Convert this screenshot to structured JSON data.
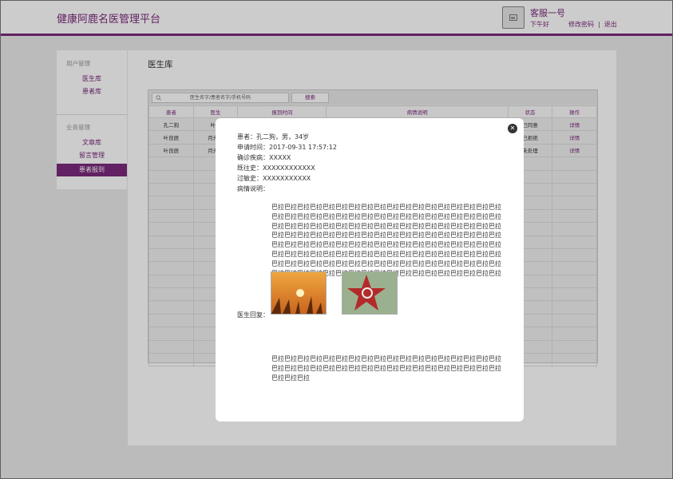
{
  "header": {
    "app_title": "健康阿鹿名医管理平台",
    "user_name": "客服一号",
    "greeting": "下午好",
    "change_password": "修改密码",
    "separator": "|",
    "logout": "退出"
  },
  "sidebar": {
    "group1": "用户管理",
    "group1_items": [
      "医生库",
      "患者库"
    ],
    "group2": "业务管理",
    "group2_items": [
      "文章库",
      "留言管理",
      "患者报到"
    ]
  },
  "page_title": "医生库",
  "search": {
    "placeholder": "医生名字/患者名字/手机号码",
    "button": "搜索"
  },
  "table": {
    "headers": [
      "患者",
      "医生",
      "报到时间",
      "病情说明",
      "状态",
      "操作"
    ],
    "rows": [
      [
        "孔二狗",
        "叶良",
        "",
        "",
        "已同意",
        "详情"
      ],
      [
        "叶良辰",
        "月光宝",
        "",
        "",
        "已拒绝",
        "详情"
      ],
      [
        "叶良辰",
        "月光宝",
        "",
        "",
        "未处理",
        "详情"
      ]
    ]
  },
  "modal": {
    "patient": "患者：孔二狗，男，34岁",
    "apply_time": "申请时间：2017-09-31 17:57:12",
    "diagnosis": "确诊疾病：XXXXX",
    "history": "既往史：XXXXXXXXXXXX",
    "allergy": "过敏史：XXXXXXXXXXX",
    "condition_label": "病情说明：",
    "condition_text": "巴拉巴拉巴拉巴拉巴拉巴拉巴拉巴拉巴拉巴拉巴拉巴拉巴拉巴拉巴拉巴拉巴拉巴拉巴拉巴拉巴拉巴拉巴拉巴拉巴拉巴拉巴拉巴拉巴拉巴拉巴拉巴拉巴拉巴拉巴拉巴拉巴拉巴拉巴拉巴拉巴拉巴拉巴拉巴拉巴拉巴拉巴拉巴拉巴拉巴拉巴拉巴拉巴拉巴拉巴拉巴拉巴拉巴拉巴拉巴拉巴拉巴拉巴拉巴拉巴拉巴拉巴拉巴拉巴拉巴拉巴拉巴拉巴拉巴拉巴拉巴拉巴拉巴拉巴拉巴拉巴拉巴拉巴拉巴拉巴拉巴拉巴拉巴拉巴拉巴拉巴拉巴拉巴拉巴拉巴拉巴拉巴拉巴拉巴拉巴拉巴拉巴拉巴拉巴拉巴拉巴拉巴拉巴拉巴拉巴拉巴拉巴拉巴拉巴拉巴拉巴拉巴拉巴拉巴拉巴拉巴拉巴拉巴拉巴拉巴拉巴拉巴拉巴拉巴拉巴拉巴拉巴拉巴拉巴拉巴拉巴拉巴拉巴拉巴拉巴拉巴拉巴拉巴拉巴拉巴拉",
    "reply_label": "医生回复：",
    "reply_text": "巴拉巴拉巴拉巴拉巴拉巴拉巴拉巴拉巴拉巴拉巴拉巴拉巴拉巴拉巴拉巴拉巴拉巴拉巴拉巴拉巴拉巴拉巴拉巴拉巴拉巴拉巴拉巴拉巴拉巴拉巴拉巴拉巴拉巴拉巴拉巴拉巴拉巴拉巴拉",
    "close_icon": "close-icon"
  },
  "colors": {
    "accent": "#7b2a7b"
  }
}
